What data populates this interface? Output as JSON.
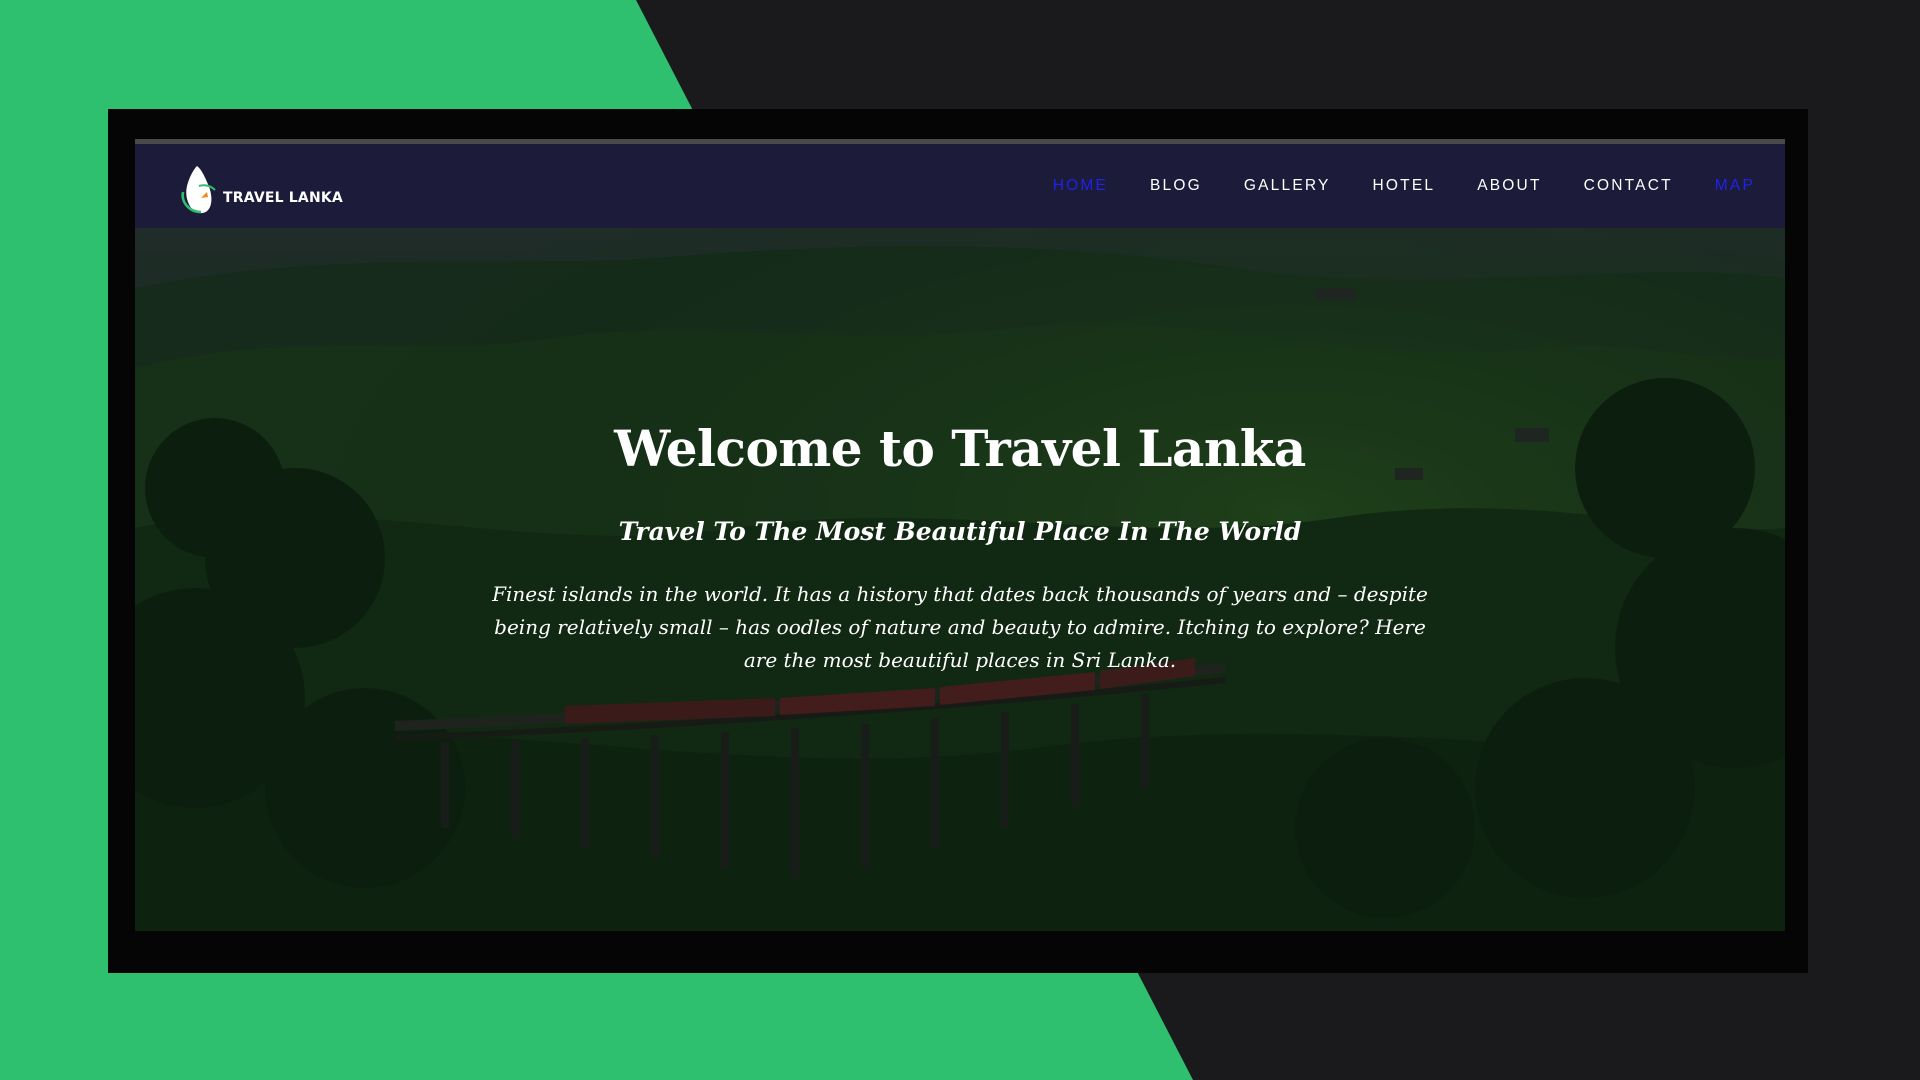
{
  "colors": {
    "accent_green": "#2ec06f",
    "background_dark": "#1a1a1c",
    "navbar": "#1c1c3a",
    "nav_active": "#1e22e6"
  },
  "logo": {
    "text": "TRAVEL LANKA",
    "icon": "sri-lanka-island-icon"
  },
  "nav": {
    "items": [
      {
        "label": "HOME",
        "color": "#1e22e6"
      },
      {
        "label": "BLOG",
        "color": "#ffffff"
      },
      {
        "label": "GALLERY",
        "color": "#ffffff"
      },
      {
        "label": "HOTEL",
        "color": "#ffffff"
      },
      {
        "label": "ABOUT",
        "color": "#ffffff"
      },
      {
        "label": "CONTACT",
        "color": "#ffffff"
      },
      {
        "label": "MAP",
        "color": "#1e22e6"
      }
    ]
  },
  "hero": {
    "title": "Welcome to Travel Lanka",
    "subtitle": "Travel To The Most Beautiful Place In The World",
    "text": "Finest islands in the world. It has a history that dates back thousands of years and – despite being relatively small – has oodles of nature and beauty to admire. Itching to explore? Here are the most beautiful places in Sri Lanka.",
    "image": "nine-arch-bridge-train-forest"
  }
}
